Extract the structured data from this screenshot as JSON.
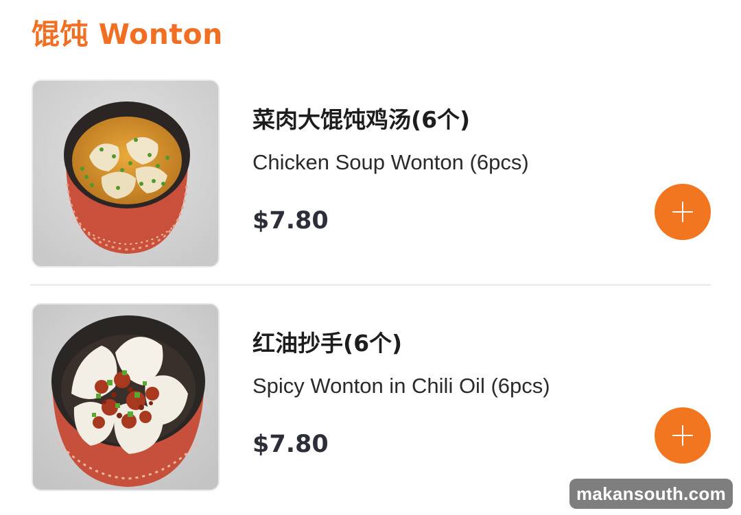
{
  "section": {
    "title": "馄饨 Wonton"
  },
  "items": [
    {
      "name_cn": "菜肉大馄饨鸡汤(6个)",
      "name_en": "Chicken Soup Wonton (6pcs)",
      "price": "$7.80",
      "image": "chicken-soup-wonton-photo",
      "add_icon": "plus-icon"
    },
    {
      "name_cn": "红油抄手(6个)",
      "name_en": "Spicy Wonton in Chili Oil (6pcs)",
      "price": "$7.80",
      "image": "spicy-wonton-chili-oil-photo",
      "add_icon": "plus-icon"
    }
  ],
  "watermark": "makansouth.com",
  "colors": {
    "accent": "#f27520",
    "title": "#f06f22",
    "price": "#2c2f3a",
    "divider": "#eceef1"
  }
}
